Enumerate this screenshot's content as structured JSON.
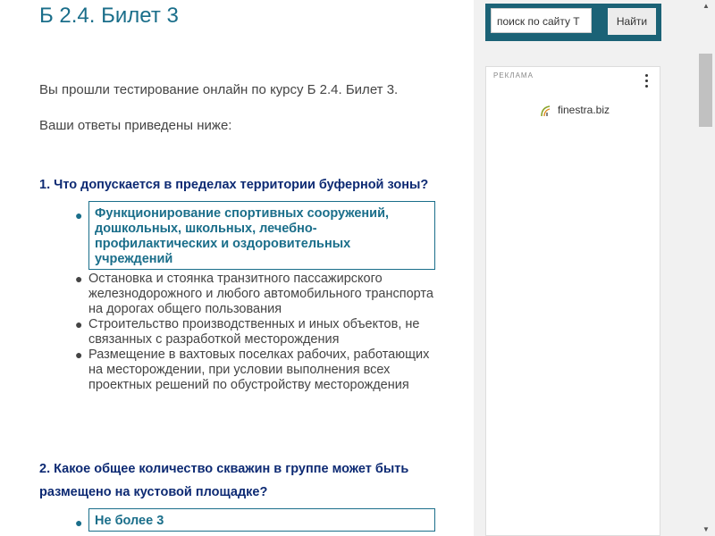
{
  "page": {
    "title": "Б 2.4. Билет 3",
    "intro": "Вы прошли тестирование онлайн по курсу Б 2.4. Билет 3.",
    "answers_intro": "Ваши ответы приведены ниже:"
  },
  "questions": [
    {
      "number": "1.",
      "text": "Что допускается в пределах территории буферной зоны?",
      "answers": [
        {
          "text": "Функционирование спортивных сооружений, дошкольных, школьных, лечебно-профилактических и оздоровительных учреждений",
          "correct": true
        },
        {
          "text": "Остановка и стоянка транзитного пассажирского железнодорожного и любого автомобильного транспорта на дорогах общего пользования",
          "correct": false
        },
        {
          "text": "Строительство производственных и иных объектов, не связанных с разработкой месторождения",
          "correct": false
        },
        {
          "text": "Размещение в вахтовых поселках рабочих, работающих на месторождении, при условии выполнения всех проектных решений по обустройству месторождения",
          "correct": false
        }
      ]
    },
    {
      "number": "2.",
      "text": "Какое общее количество скважин в группе может быть размещено на кустовой площадке?",
      "answers": [
        {
          "text": "Не более 3",
          "correct": true
        }
      ]
    }
  ],
  "search": {
    "value": "поиск по сайту Т",
    "button_label": "Найти"
  },
  "ad": {
    "label": "РЕКЛАМА",
    "link_text": "finestra.biz",
    "menu_icon": "more-vert-icon"
  },
  "colors": {
    "accent": "#1a6e8a",
    "question": "#0d2a73",
    "search_bg": "#1b6276",
    "sidebar_bg": "#f1f1f1"
  }
}
